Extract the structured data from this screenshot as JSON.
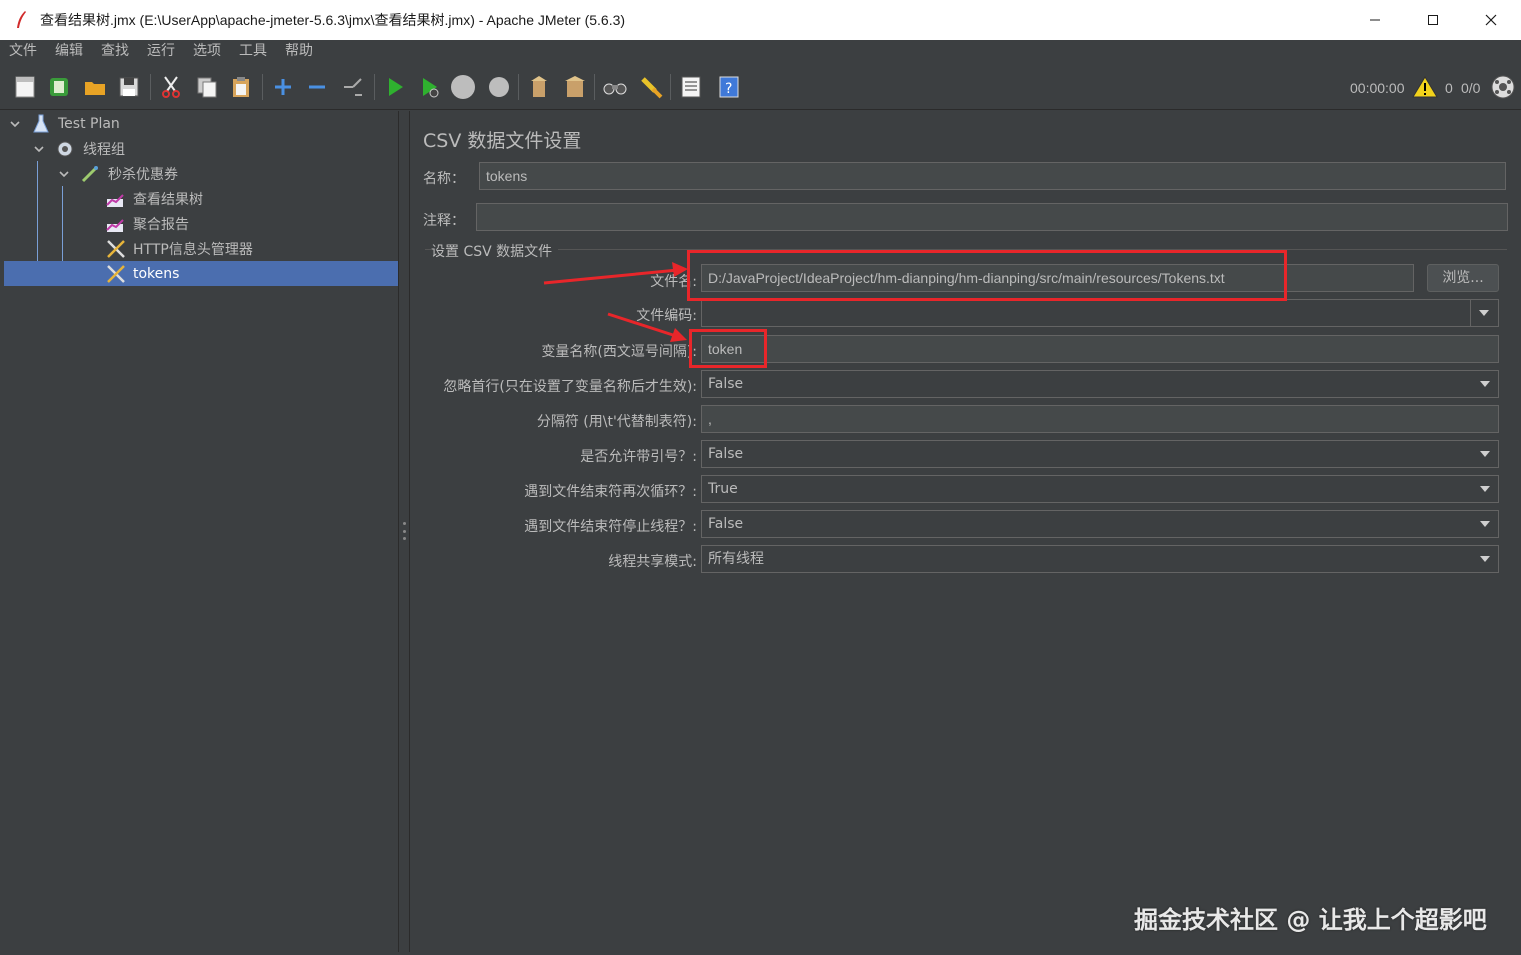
{
  "window": {
    "title": "查看结果树.jmx (E:\\UserApp\\apache-jmeter-5.6.3\\jmx\\查看结果树.jmx) - Apache JMeter (5.6.3)"
  },
  "menu": [
    "文件",
    "编辑",
    "查找",
    "运行",
    "选项",
    "工具",
    "帮助"
  ],
  "toolbar": {
    "timer": "00:00:00",
    "warning_count": "0",
    "thread_count": "0/0"
  },
  "tree": {
    "items": [
      {
        "label": "Test Plan",
        "icon": "test-plan-icon"
      },
      {
        "label": "线程组",
        "icon": "gear-icon"
      },
      {
        "label": "秒杀优惠券",
        "icon": "pipette-icon"
      },
      {
        "label": "查看结果树",
        "icon": "chart-icon"
      },
      {
        "label": "聚合报告",
        "icon": "chart-icon"
      },
      {
        "label": "HTTP信息头管理器",
        "icon": "tools-icon"
      },
      {
        "label": "tokens",
        "icon": "tools-icon"
      }
    ],
    "selected": "tokens"
  },
  "panel": {
    "title": "CSV 数据文件设置",
    "name_label": "名称：",
    "name_value": "tokens",
    "comment_label": "注释：",
    "comment_value": "",
    "group_title": "设置 CSV 数据文件",
    "filename_label": "文件名:",
    "filename_value": "D:/JavaProject/IdeaProject/hm-dianping/hm-dianping/src/main/resources/Tokens.txt",
    "browse_label": "浏览...",
    "encoding_label": "文件编码:",
    "encoding_value": "",
    "varnames_label": "变量名称(西文逗号间隔):",
    "varnames_value": "token",
    "ignore_first_label": "忽略首行(只在设置了变量名称后才生效):",
    "ignore_first_value": "False",
    "delimiter_label": "分隔符 (用\\t'代替制表符):",
    "delimiter_value": ",",
    "quoted_label": "是否允许带引号？:",
    "quoted_value": "False",
    "recycle_label": "遇到文件结束符再次循环？:",
    "recycle_value": "True",
    "stop_label": "遇到文件结束符停止线程？:",
    "stop_value": "False",
    "share_label": "线程共享模式:",
    "share_value": "所有线程"
  },
  "watermark": "掘金技术社区 @ 让我上个超影吧",
  "colors": {
    "background": "#3c3f41",
    "selection": "#4b6eaf",
    "annotation_red": "#e8262a"
  }
}
